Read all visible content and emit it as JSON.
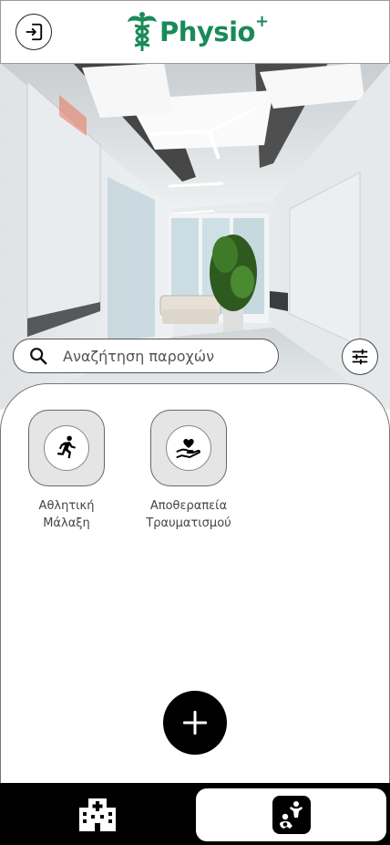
{
  "header": {
    "logo_text": "Physio",
    "logo_sup": "+",
    "logout_icon": "logout-icon"
  },
  "search": {
    "placeholder": "Αναζήτηση παροχών",
    "icon": "search-icon",
    "filter_icon": "tune-icon"
  },
  "services": [
    {
      "label": "Αθλητική\nΜάλαξη",
      "icon": "running-icon"
    },
    {
      "label": "Αποθεραπεία\nΤραυματισμού",
      "icon": "hand-heart-icon"
    }
  ],
  "actions": {
    "add_icon": "plus-icon"
  },
  "bottom_nav": {
    "items": [
      {
        "icon": "hospital-icon",
        "active": false
      },
      {
        "icon": "therapy-icon",
        "active": true
      }
    ]
  }
}
